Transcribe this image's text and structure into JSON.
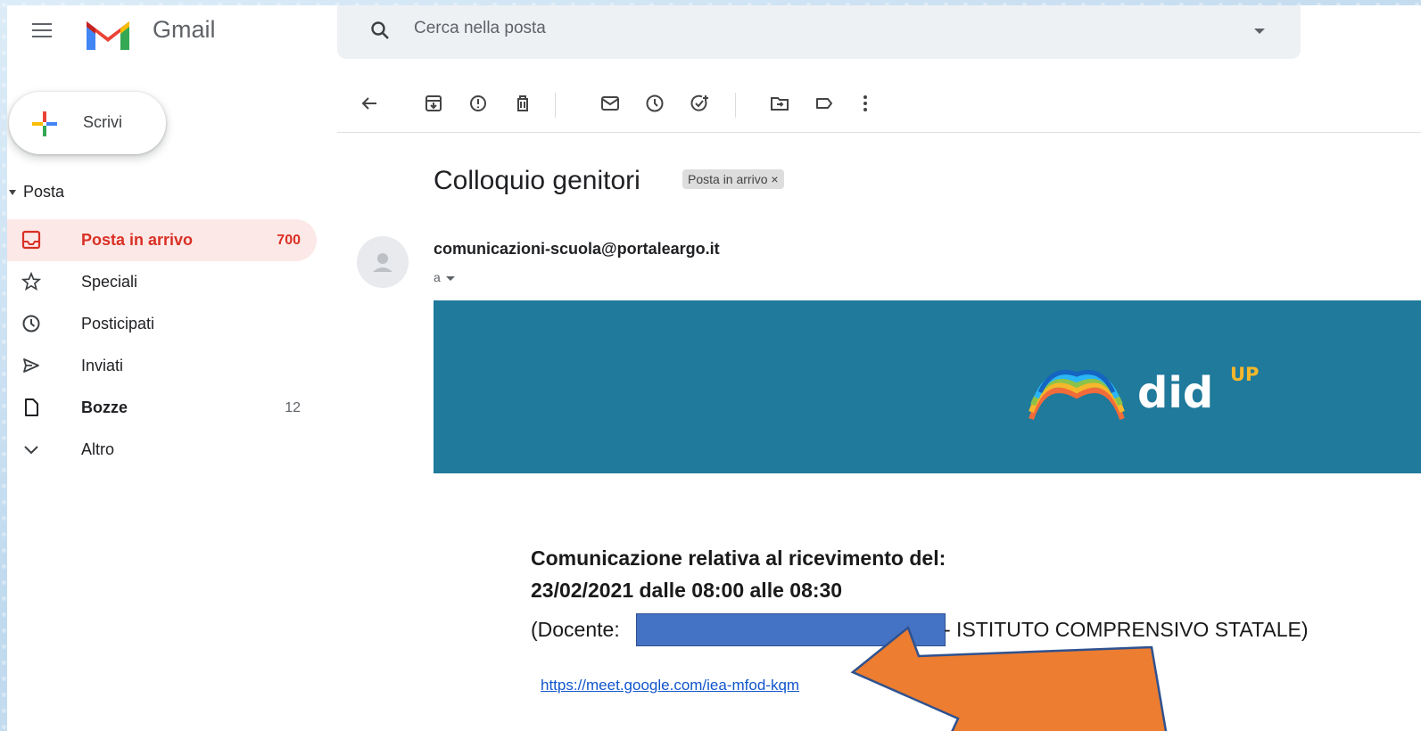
{
  "header": {
    "app_name": "Gmail",
    "search_placeholder": "Cerca nella posta"
  },
  "sidebar": {
    "compose_label": "Scrivi",
    "section_label": "Posta",
    "items": [
      {
        "label": "Posta in arrivo",
        "count": "700",
        "icon": "inbox-icon",
        "active": true
      },
      {
        "label": "Speciali",
        "count": "",
        "icon": "star-icon"
      },
      {
        "label": "Posticipati",
        "count": "",
        "icon": "clock-icon"
      },
      {
        "label": "Inviati",
        "count": "",
        "icon": "send-icon"
      },
      {
        "label": "Bozze",
        "count": "12",
        "icon": "draft-icon",
        "bold": true
      },
      {
        "label": "Altro",
        "count": "",
        "icon": "chevron-down-icon"
      }
    ]
  },
  "toolbar": {
    "buttons": [
      "back-icon",
      "archive-icon",
      "report-spam-icon",
      "delete-icon",
      "mark-unread-icon",
      "snooze-icon",
      "add-task-icon",
      "move-to-icon",
      "label-icon",
      "more-icon"
    ]
  },
  "email": {
    "subject": "Colloquio genitori",
    "label_chip": "Posta in arrivo ×",
    "sender": "comunicazioni-scuola@portaleargo.it",
    "recipient": "a",
    "banner": {
      "brand": "did",
      "brand_sup": "UP",
      "color": "#1f7a9b"
    },
    "body": {
      "heading_line1": "Comunicazione relativa al ricevimento del:",
      "heading_line2": "23/02/2021 dalle 08:00 alle 08:30",
      "teacher_prefix": "(Docente:",
      "school": "- ISTITUTO COMPRENSIVO STATALE)",
      "meet_link": "https://meet.google.com/iea-mfod-kqm"
    }
  },
  "colors": {
    "active_bg": "#fce8e6",
    "active_text": "#d93025",
    "link": "#1155cc",
    "arrow": "#ed7d31",
    "redaction": "#4472c4"
  }
}
